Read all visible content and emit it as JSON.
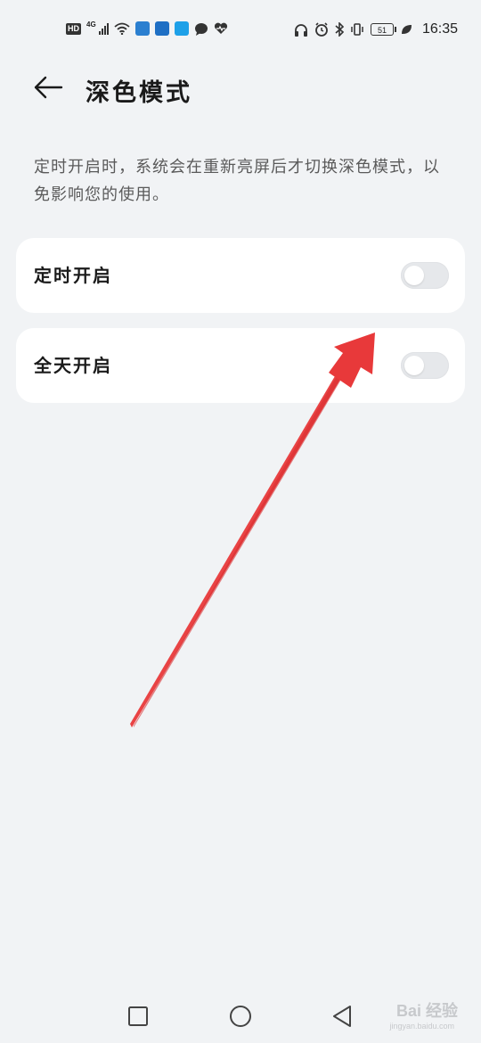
{
  "status_bar": {
    "hd": "HD",
    "network": "4G",
    "battery": "51",
    "time": "16:35",
    "icons_left": [
      "hd-icon",
      "signal-icon",
      "wifi-icon",
      "app-weather-icon",
      "app-files-icon",
      "app-search-icon",
      "chat-icon",
      "health-icon"
    ],
    "icons_right": [
      "headphones-icon",
      "alarm-icon",
      "bluetooth-icon",
      "vibrate-icon",
      "battery-icon",
      "leaf-icon"
    ]
  },
  "header": {
    "back_icon": "arrow-left-icon",
    "title": "深色模式"
  },
  "description": "定时开启时，系统会在重新亮屏后才切换深色模式，以免影响您的使用。",
  "options": [
    {
      "label": "定时开启",
      "enabled": false
    },
    {
      "label": "全天开启",
      "enabled": false
    }
  ],
  "annotation": {
    "color": "#e8393a",
    "icon": "red-arrow-annotation"
  },
  "nav_bar": {
    "icons": [
      "recents-square-icon",
      "home-circle-icon",
      "back-triangle-icon"
    ]
  },
  "watermark": {
    "text": "Bai 经验",
    "sub": "jingyan.baidu.com"
  }
}
